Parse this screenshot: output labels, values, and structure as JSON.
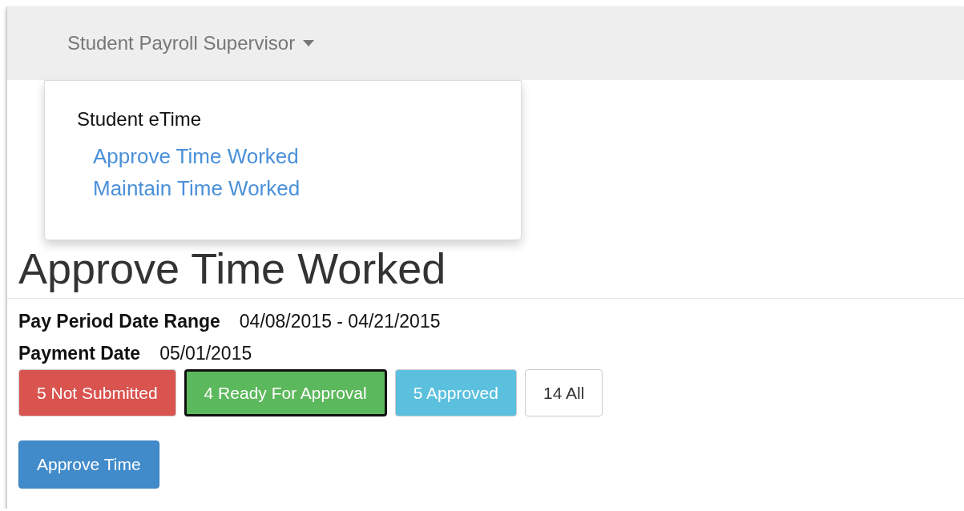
{
  "navbar": {
    "menu_label": "Student Payroll Supervisor",
    "dropdown": {
      "expanded": true,
      "header": "Student eTime",
      "items": [
        {
          "label": "Approve Time Worked"
        },
        {
          "label": "Maintain Time Worked"
        }
      ]
    }
  },
  "page": {
    "title": "Approve Time Worked",
    "fields": [
      {
        "label": "Pay Period Date Range",
        "value": "04/08/2015 - 04/21/2015"
      },
      {
        "label": "Payment Date",
        "value": "05/01/2015"
      }
    ],
    "filters": [
      {
        "label": "5 Not Submitted",
        "color": "#d9534f",
        "selected": false
      },
      {
        "label": "4 Ready For Approval",
        "color": "#5cb85c",
        "selected": true
      },
      {
        "label": "5 Approved",
        "color": "#5bc0de",
        "selected": false
      },
      {
        "label": "14 All",
        "color": "#ffffff",
        "selected": false
      }
    ],
    "action_button": "Approve Time"
  }
}
